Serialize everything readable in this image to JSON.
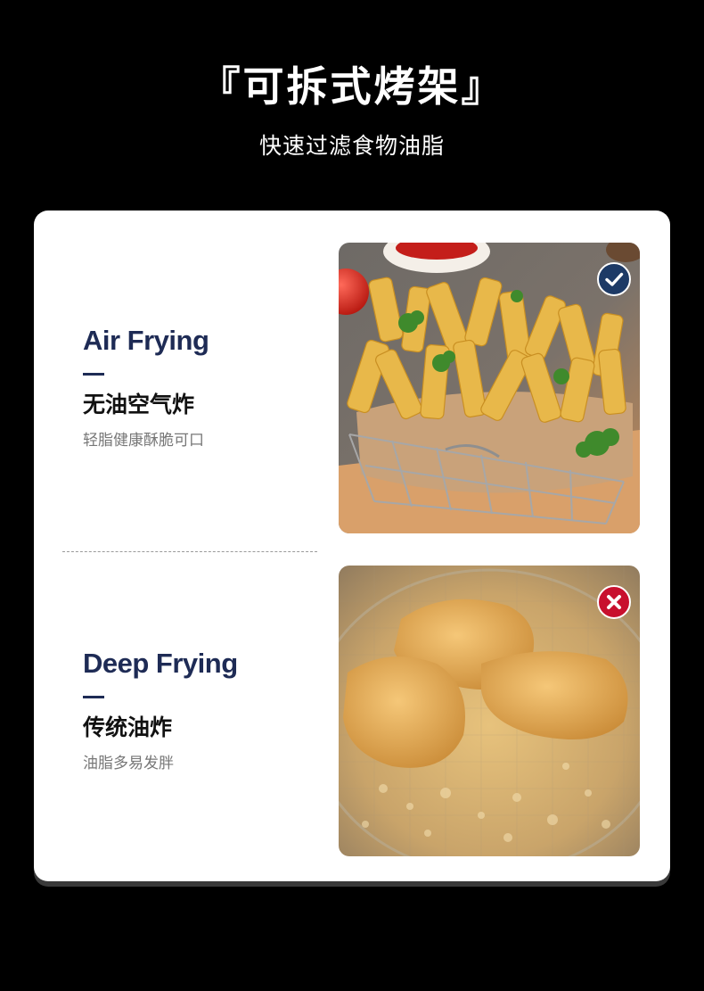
{
  "header": {
    "title": "『可拆式烤架』",
    "subtitle": "快速过滤食物油脂"
  },
  "comparison": [
    {
      "en": "Air Frying",
      "cn": "无油空气炸",
      "desc": "轻脂健康酥脆可口",
      "badge": "check-icon",
      "badge_color": "#1d3a66",
      "photo": "air-fried-fries-photo"
    },
    {
      "en": "Deep Frying",
      "cn": "传统油炸",
      "desc": "油脂多易发胖",
      "badge": "cross-icon",
      "badge_color": "#c8102e",
      "photo": "deep-fried-chicken-photo"
    }
  ],
  "colors": {
    "background": "#000000",
    "card": "#ffffff",
    "accent_navy": "#1e2b55",
    "accent_red": "#c8102e"
  }
}
